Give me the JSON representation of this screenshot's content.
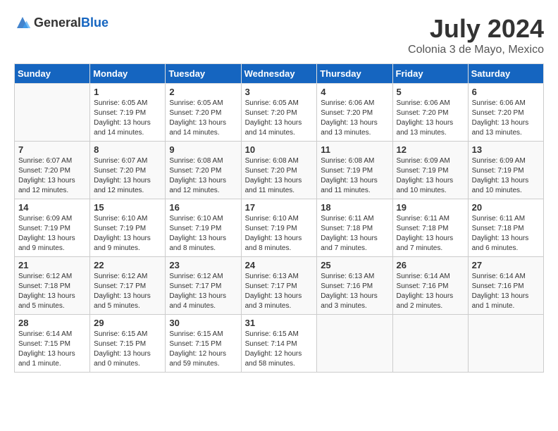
{
  "header": {
    "logo_general": "General",
    "logo_blue": "Blue",
    "month_title": "July 2024",
    "location": "Colonia 3 de Mayo, Mexico"
  },
  "columns": [
    "Sunday",
    "Monday",
    "Tuesday",
    "Wednesday",
    "Thursday",
    "Friday",
    "Saturday"
  ],
  "weeks": [
    [
      {
        "day": "",
        "sunrise": "",
        "sunset": "",
        "daylight": ""
      },
      {
        "day": "1",
        "sunrise": "Sunrise: 6:05 AM",
        "sunset": "Sunset: 7:19 PM",
        "daylight": "Daylight: 13 hours and 14 minutes."
      },
      {
        "day": "2",
        "sunrise": "Sunrise: 6:05 AM",
        "sunset": "Sunset: 7:20 PM",
        "daylight": "Daylight: 13 hours and 14 minutes."
      },
      {
        "day": "3",
        "sunrise": "Sunrise: 6:05 AM",
        "sunset": "Sunset: 7:20 PM",
        "daylight": "Daylight: 13 hours and 14 minutes."
      },
      {
        "day": "4",
        "sunrise": "Sunrise: 6:06 AM",
        "sunset": "Sunset: 7:20 PM",
        "daylight": "Daylight: 13 hours and 13 minutes."
      },
      {
        "day": "5",
        "sunrise": "Sunrise: 6:06 AM",
        "sunset": "Sunset: 7:20 PM",
        "daylight": "Daylight: 13 hours and 13 minutes."
      },
      {
        "day": "6",
        "sunrise": "Sunrise: 6:06 AM",
        "sunset": "Sunset: 7:20 PM",
        "daylight": "Daylight: 13 hours and 13 minutes."
      }
    ],
    [
      {
        "day": "7",
        "sunrise": "Sunrise: 6:07 AM",
        "sunset": "Sunset: 7:20 PM",
        "daylight": "Daylight: 13 hours and 12 minutes."
      },
      {
        "day": "8",
        "sunrise": "Sunrise: 6:07 AM",
        "sunset": "Sunset: 7:20 PM",
        "daylight": "Daylight: 13 hours and 12 minutes."
      },
      {
        "day": "9",
        "sunrise": "Sunrise: 6:08 AM",
        "sunset": "Sunset: 7:20 PM",
        "daylight": "Daylight: 13 hours and 12 minutes."
      },
      {
        "day": "10",
        "sunrise": "Sunrise: 6:08 AM",
        "sunset": "Sunset: 7:20 PM",
        "daylight": "Daylight: 13 hours and 11 minutes."
      },
      {
        "day": "11",
        "sunrise": "Sunrise: 6:08 AM",
        "sunset": "Sunset: 7:19 PM",
        "daylight": "Daylight: 13 hours and 11 minutes."
      },
      {
        "day": "12",
        "sunrise": "Sunrise: 6:09 AM",
        "sunset": "Sunset: 7:19 PM",
        "daylight": "Daylight: 13 hours and 10 minutes."
      },
      {
        "day": "13",
        "sunrise": "Sunrise: 6:09 AM",
        "sunset": "Sunset: 7:19 PM",
        "daylight": "Daylight: 13 hours and 10 minutes."
      }
    ],
    [
      {
        "day": "14",
        "sunrise": "Sunrise: 6:09 AM",
        "sunset": "Sunset: 7:19 PM",
        "daylight": "Daylight: 13 hours and 9 minutes."
      },
      {
        "day": "15",
        "sunrise": "Sunrise: 6:10 AM",
        "sunset": "Sunset: 7:19 PM",
        "daylight": "Daylight: 13 hours and 9 minutes."
      },
      {
        "day": "16",
        "sunrise": "Sunrise: 6:10 AM",
        "sunset": "Sunset: 7:19 PM",
        "daylight": "Daylight: 13 hours and 8 minutes."
      },
      {
        "day": "17",
        "sunrise": "Sunrise: 6:10 AM",
        "sunset": "Sunset: 7:19 PM",
        "daylight": "Daylight: 13 hours and 8 minutes."
      },
      {
        "day": "18",
        "sunrise": "Sunrise: 6:11 AM",
        "sunset": "Sunset: 7:18 PM",
        "daylight": "Daylight: 13 hours and 7 minutes."
      },
      {
        "day": "19",
        "sunrise": "Sunrise: 6:11 AM",
        "sunset": "Sunset: 7:18 PM",
        "daylight": "Daylight: 13 hours and 7 minutes."
      },
      {
        "day": "20",
        "sunrise": "Sunrise: 6:11 AM",
        "sunset": "Sunset: 7:18 PM",
        "daylight": "Daylight: 13 hours and 6 minutes."
      }
    ],
    [
      {
        "day": "21",
        "sunrise": "Sunrise: 6:12 AM",
        "sunset": "Sunset: 7:18 PM",
        "daylight": "Daylight: 13 hours and 5 minutes."
      },
      {
        "day": "22",
        "sunrise": "Sunrise: 6:12 AM",
        "sunset": "Sunset: 7:17 PM",
        "daylight": "Daylight: 13 hours and 5 minutes."
      },
      {
        "day": "23",
        "sunrise": "Sunrise: 6:12 AM",
        "sunset": "Sunset: 7:17 PM",
        "daylight": "Daylight: 13 hours and 4 minutes."
      },
      {
        "day": "24",
        "sunrise": "Sunrise: 6:13 AM",
        "sunset": "Sunset: 7:17 PM",
        "daylight": "Daylight: 13 hours and 3 minutes."
      },
      {
        "day": "25",
        "sunrise": "Sunrise: 6:13 AM",
        "sunset": "Sunset: 7:16 PM",
        "daylight": "Daylight: 13 hours and 3 minutes."
      },
      {
        "day": "26",
        "sunrise": "Sunrise: 6:14 AM",
        "sunset": "Sunset: 7:16 PM",
        "daylight": "Daylight: 13 hours and 2 minutes."
      },
      {
        "day": "27",
        "sunrise": "Sunrise: 6:14 AM",
        "sunset": "Sunset: 7:16 PM",
        "daylight": "Daylight: 13 hours and 1 minute."
      }
    ],
    [
      {
        "day": "28",
        "sunrise": "Sunrise: 6:14 AM",
        "sunset": "Sunset: 7:15 PM",
        "daylight": "Daylight: 13 hours and 1 minute."
      },
      {
        "day": "29",
        "sunrise": "Sunrise: 6:15 AM",
        "sunset": "Sunset: 7:15 PM",
        "daylight": "Daylight: 13 hours and 0 minutes."
      },
      {
        "day": "30",
        "sunrise": "Sunrise: 6:15 AM",
        "sunset": "Sunset: 7:15 PM",
        "daylight": "Daylight: 12 hours and 59 minutes."
      },
      {
        "day": "31",
        "sunrise": "Sunrise: 6:15 AM",
        "sunset": "Sunset: 7:14 PM",
        "daylight": "Daylight: 12 hours and 58 minutes."
      },
      {
        "day": "",
        "sunrise": "",
        "sunset": "",
        "daylight": ""
      },
      {
        "day": "",
        "sunrise": "",
        "sunset": "",
        "daylight": ""
      },
      {
        "day": "",
        "sunrise": "",
        "sunset": "",
        "daylight": ""
      }
    ]
  ]
}
